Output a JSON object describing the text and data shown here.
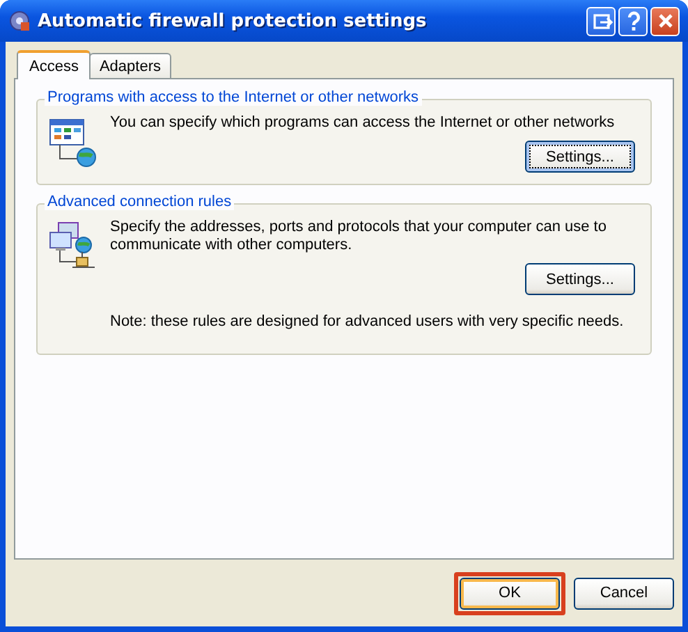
{
  "window": {
    "title": "Automatic firewall protection settings",
    "controls": [
      {
        "kind": "minimize"
      },
      {
        "kind": "help"
      },
      {
        "kind": "close"
      }
    ]
  },
  "tabs": [
    {
      "label": "Access",
      "selected": true
    },
    {
      "label": "Adapters",
      "selected": false
    }
  ],
  "groups": [
    {
      "title": "Programs with access to the Internet or other networks",
      "texts": [
        "You can specify which programs can access the Internet or other networks"
      ],
      "button": {
        "label": "Settings...",
        "focused": true
      }
    },
    {
      "title": "Advanced connection rules",
      "texts": [
        "Specify the addresses, ports and protocols that your computer can use to communicate with other computers."
      ],
      "button": {
        "label": "Settings...",
        "focused": false
      },
      "note": "Note: these rules are designed for advanced users with very specific needs."
    }
  ],
  "buttons": [
    {
      "label": "OK",
      "default": true,
      "highlighted": true
    },
    {
      "label": "Cancel",
      "default": false,
      "highlighted": false
    }
  ]
}
